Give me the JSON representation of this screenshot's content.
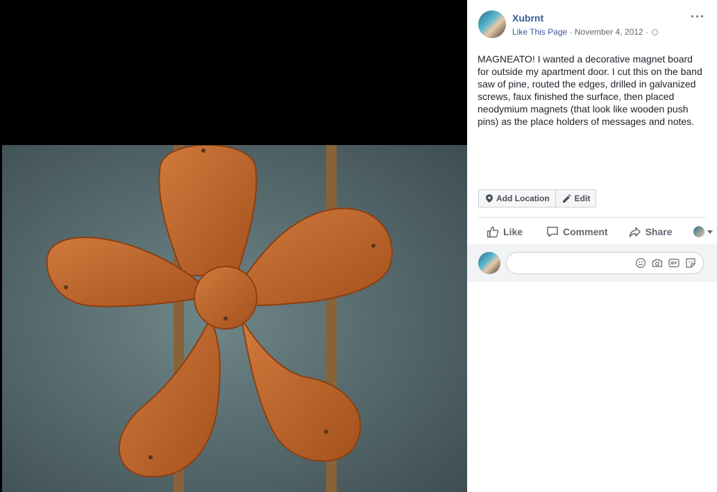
{
  "post": {
    "author": "Xubrnt",
    "like_page": "Like This Page",
    "separator": "·",
    "date": "November 4, 2012",
    "text": "MAGNEATO! I wanted a decorative magnet board for outside my apartment door. I cut this on the band saw of pine, routed the edges, drilled in galvanized screws, faux finished the surface, then placed neodymium magnets (that look like wooden push pins) as the place holders of messages and notes."
  },
  "menu": {
    "more": "···"
  },
  "actions": {
    "add_location": "Add Location",
    "edit": "Edit"
  },
  "reactions": {
    "like": "Like",
    "comment": "Comment",
    "share": "Share"
  },
  "comment": {
    "placeholder": ""
  },
  "icons": [
    "globe-icon",
    "more-options-icon",
    "location-pin-icon",
    "pencil-icon",
    "thumbs-up-icon",
    "comment-bubble-icon",
    "share-arrow-icon",
    "caret-down-icon",
    "emoji-icon",
    "camera-icon",
    "gif-icon",
    "sticker-icon"
  ],
  "colors": {
    "link": "#365899",
    "meta": "#616770",
    "text": "#1d2129",
    "comment_bg": "#f2f3f5"
  }
}
